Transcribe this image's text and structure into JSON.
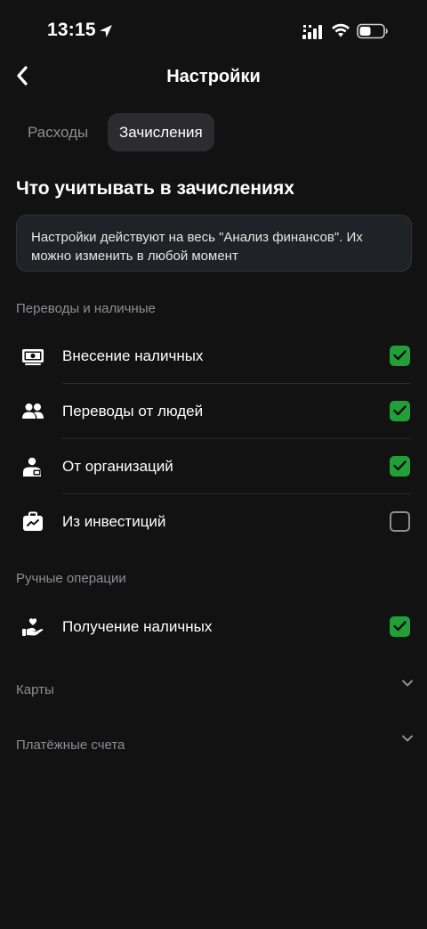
{
  "status_bar": {
    "time": "13:15"
  },
  "header": {
    "title": "Настройки",
    "back_label": "Назад"
  },
  "tabs": [
    {
      "label": "Расходы",
      "active": false
    },
    {
      "label": "Зачисления",
      "active": true
    }
  ],
  "section_title": "Что учитывать в зачислениях",
  "info_text": "Настройки действуют на весь \"Анализ финансов\". Их можно изменить в любой момент",
  "groups": [
    {
      "label": "Переводы и наличные",
      "items": [
        {
          "label": "Внесение наличных",
          "icon": "cash-icon",
          "checked": true
        },
        {
          "label": "Переводы от людей",
          "icon": "people-icon",
          "checked": true
        },
        {
          "label": "От организаций",
          "icon": "organization-icon",
          "checked": true
        },
        {
          "label": "Из инвестиций",
          "icon": "briefcase-icon",
          "checked": false
        }
      ]
    },
    {
      "label": "Ручные операции",
      "items": [
        {
          "label": "Получение наличных",
          "icon": "hand-heart-icon",
          "checked": true
        }
      ]
    }
  ],
  "collapsible_sections": [
    {
      "label": "Карты"
    },
    {
      "label": "Платёжные счета"
    }
  ],
  "colors": {
    "accent": "#21a038",
    "background": "#121212",
    "muted_text": "#8e8e93"
  }
}
